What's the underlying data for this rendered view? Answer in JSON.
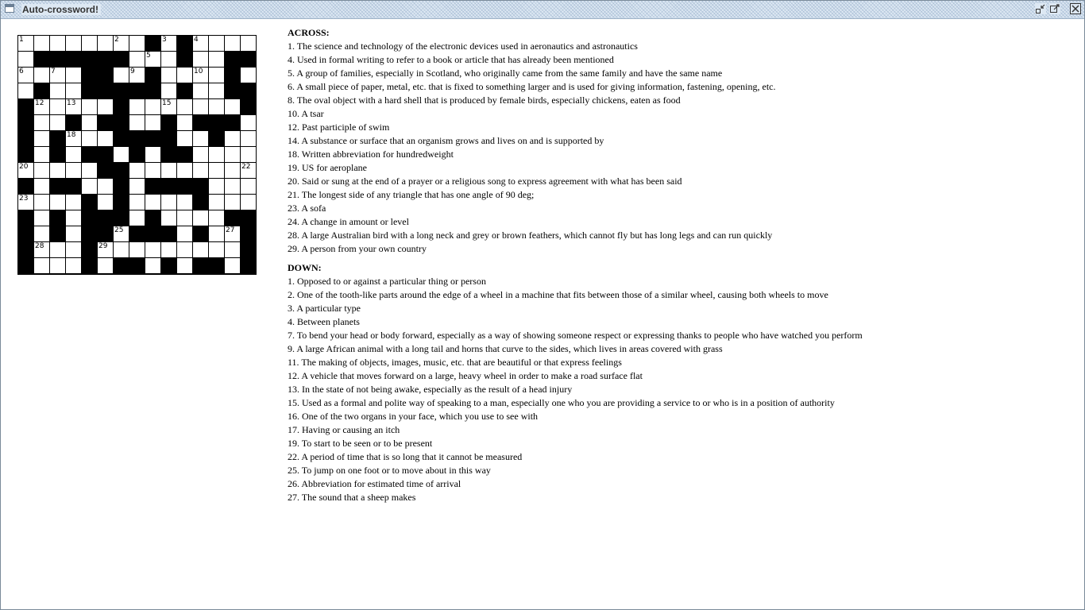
{
  "window": {
    "title": "Auto-crossword!",
    "icons": [
      "window-icon",
      "minimize-icon",
      "restore-icon",
      "close-icon"
    ]
  },
  "puzzle": {
    "rows": 15,
    "cols": 15,
    "cells": [
      "--------#-#----",
      "-######---#--##",
      "----##--#----#-",
      "-#--#####-#--##",
      "#-----#-------#",
      "#--#-##--#-###-",
      "#-#---####--#--",
      "#-#-##-#-##----",
      "-----##--------",
      "#-##--#-####---",
      "----#-#----#---",
      "#-#-###-#----##",
      "#-#-##-###-#--#",
      "#---#---------#",
      "#---#-##-#-##-#"
    ],
    "numbers": [
      {
        "r": 0,
        "c": 0,
        "n": "1"
      },
      {
        "r": 0,
        "c": 6,
        "n": "2"
      },
      {
        "r": 0,
        "c": 9,
        "n": "3"
      },
      {
        "r": 0,
        "c": 11,
        "n": "4"
      },
      {
        "r": 1,
        "c": 8,
        "n": "5"
      },
      {
        "r": 2,
        "c": 0,
        "n": "6"
      },
      {
        "r": 2,
        "c": 2,
        "n": "7"
      },
      {
        "r": 2,
        "c": 5,
        "n": "8"
      },
      {
        "r": 2,
        "c": 7,
        "n": "9"
      },
      {
        "r": 2,
        "c": 11,
        "n": "10"
      },
      {
        "r": 2,
        "c": 13,
        "n": "11"
      },
      {
        "r": 4,
        "c": 1,
        "n": "12"
      },
      {
        "r": 4,
        "c": 3,
        "n": "13"
      },
      {
        "r": 4,
        "c": 6,
        "n": "14"
      },
      {
        "r": 4,
        "c": 9,
        "n": "15"
      },
      {
        "r": 4,
        "c": 14,
        "n": "16"
      },
      {
        "r": 5,
        "c": 5,
        "n": "17"
      },
      {
        "r": 6,
        "c": 3,
        "n": "18"
      },
      {
        "r": 6,
        "c": 7,
        "n": "19"
      },
      {
        "r": 8,
        "c": 0,
        "n": "20"
      },
      {
        "r": 8,
        "c": 5,
        "n": "21"
      },
      {
        "r": 8,
        "c": 14,
        "n": "22"
      },
      {
        "r": 10,
        "c": 0,
        "n": "23"
      },
      {
        "r": 10,
        "c": 6,
        "n": "24"
      },
      {
        "r": 12,
        "c": 6,
        "n": "25"
      },
      {
        "r": 12,
        "c": 9,
        "n": "26"
      },
      {
        "r": 12,
        "c": 13,
        "n": "27"
      },
      {
        "r": 13,
        "c": 1,
        "n": "28"
      },
      {
        "r": 13,
        "c": 5,
        "n": "29"
      }
    ]
  },
  "across": {
    "heading": "ACROSS:",
    "clues": [
      "1. The science and technology of the electronic devices used in aeronautics and astronautics",
      "4. Used in formal writing to refer to a book or article that has already been mentioned",
      "5. A group of families, especially in Scotland, who originally came from the same family and have the same name",
      "6. A small piece of paper, metal, etc. that is fixed to something larger and is used for giving information, fastening, opening, etc.",
      "8. The oval object with a hard shell that is produced by female birds, especially chickens, eaten as food",
      "10. A tsar",
      "12. Past participle of swim",
      "14. A substance or surface that an organism grows and lives on and is supported by",
      "18. Written abbreviation for hundredweight",
      "19. US for aeroplane",
      "20. Said or sung at the end of a prayer or a religious song to express agreement with what has been said",
      "21. The longest side of any triangle that has one angle of 90 deg;",
      "23. A sofa",
      "24. A change in amount or level",
      "28. A large Australian bird with a long neck and grey or brown feathers, which cannot fly but has long legs and can run quickly",
      "29. A person from your own country"
    ]
  },
  "down": {
    "heading": "DOWN:",
    "clues": [
      "1. Opposed to or against a particular thing or person",
      "2. One of the tooth-like parts around the edge of a wheel in a machine that fits between those of a similar wheel, causing both wheels to move",
      "3. A particular type",
      "4. Between planets",
      "7. To bend your head or body forward, especially as a way of showing someone respect or expressing thanks to people who have watched you perform",
      "9. A large African animal with a long tail and horns that curve to the sides, which lives in areas covered with grass",
      "11. The making of objects, images, music, etc. that are beautiful or that express feelings",
      "12. A vehicle that moves forward on a large, heavy wheel in order to make a road surface flat",
      "13. In the state of not being awake, especially as the result of a head injury",
      "15. Used as a formal and polite way of speaking to a man, especially one who you are providing a service to or who is in a position of authority",
      "16. One of the two organs in your face, which you use to see with",
      "17. Having or causing an itch",
      "19. To start to be seen or to be present",
      "22. A period of time that is so long that it cannot be measured",
      "25. To jump on one foot or to move about in this way",
      "26. Abbreviation for estimated time of arrival",
      "27. The sound that a sheep makes"
    ]
  }
}
